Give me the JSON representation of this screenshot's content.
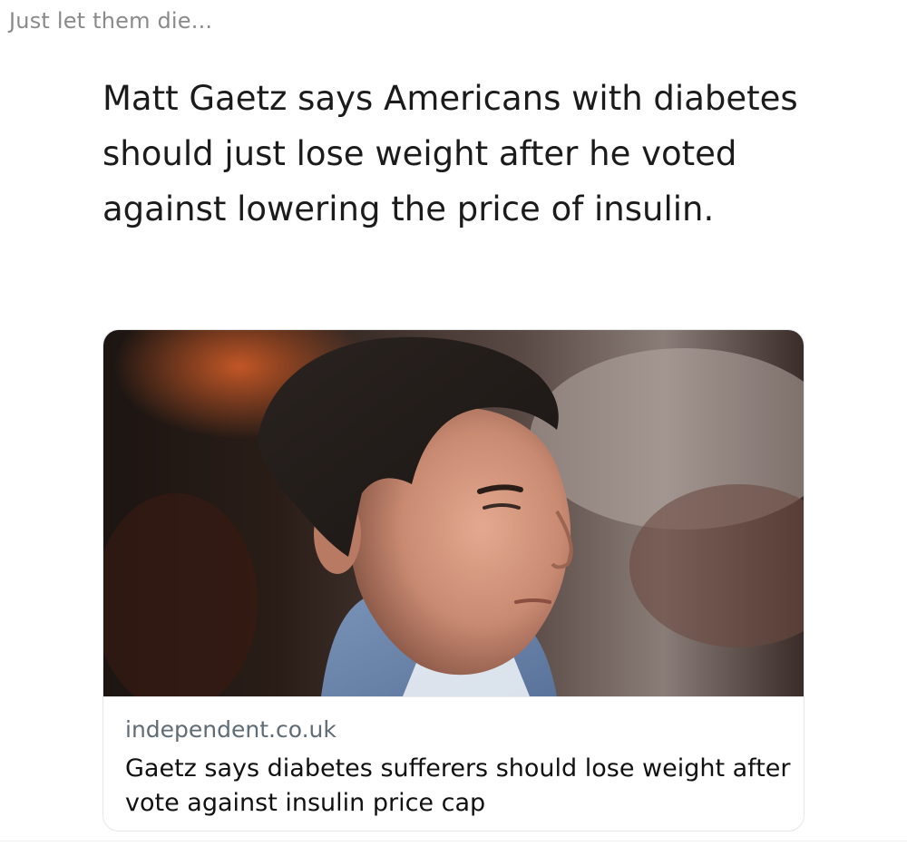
{
  "post": {
    "title": "Just let them die..."
  },
  "tweet": {
    "text": "Matt Gaetz says Americans with diabetes should just lose weight after he voted against lowering the price of insulin."
  },
  "link_card": {
    "domain": "independent.co.uk",
    "headline": "Gaetz says diabetes sufferers should lose weight after vote against insulin price cap",
    "image_icon": "photo-of-man-in-profile"
  },
  "colors": {
    "title_gray": "#8a8a8a",
    "text_dark": "#1b1b1b",
    "domain_gray": "#5f6b75",
    "card_border": "#e3e7ea"
  }
}
